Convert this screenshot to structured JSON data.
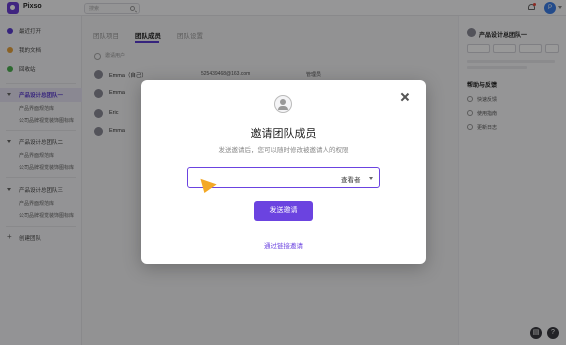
{
  "app": {
    "name": "Pixso"
  },
  "topbar": {
    "search_placeholder": "搜索",
    "avatar_initial": "P"
  },
  "sidebar": {
    "nav": [
      {
        "label": "最近打开",
        "color": "#5b3dd1"
      },
      {
        "label": "我的文档",
        "color": "#e6a23c"
      },
      {
        "label": "回收站",
        "color": "#4caf50"
      }
    ],
    "teams": [
      {
        "label": "产品设计总团队一",
        "subs": [
          "产品界面规范库",
          "公司品牌视觉装饰图标库"
        ]
      },
      {
        "label": "产品设计总团队二",
        "subs": [
          "产品界面规范库",
          "公司品牌视觉装饰图标库"
        ]
      },
      {
        "label": "产品设计总团队三",
        "subs": [
          "产品界面规范库",
          "公司品牌视觉装饰图标库"
        ]
      }
    ],
    "create_team": "创建团队"
  },
  "main": {
    "tabs": [
      {
        "label": "团队项目"
      },
      {
        "label": "团队成员"
      },
      {
        "label": "团队设置"
      }
    ],
    "add_member": "邀请用户",
    "members": [
      {
        "name": "Emma（自己）",
        "email": "525439468@163.com",
        "role": "管理员"
      },
      {
        "name": "Emma",
        "email": "",
        "role": ""
      },
      {
        "name": "Eric",
        "email": "",
        "role": ""
      },
      {
        "name": "Emma",
        "email": "",
        "role": ""
      }
    ]
  },
  "right_panel": {
    "team_name": "产品设计总团队一",
    "help_title": "帮助与反馈",
    "links": [
      "快速反馈",
      "使用指南",
      "更新日志"
    ]
  },
  "modal": {
    "title": "邀请团队成员",
    "subtitle": "发送邀请后，您可以随时修改被邀请人的权限",
    "role_value": "查看者",
    "send_label": "发送邀请",
    "link_invite_label": "通过链接邀请"
  },
  "colors": {
    "accent": "#6b43e0",
    "overlay": "rgba(0,0,0,0.40)"
  }
}
